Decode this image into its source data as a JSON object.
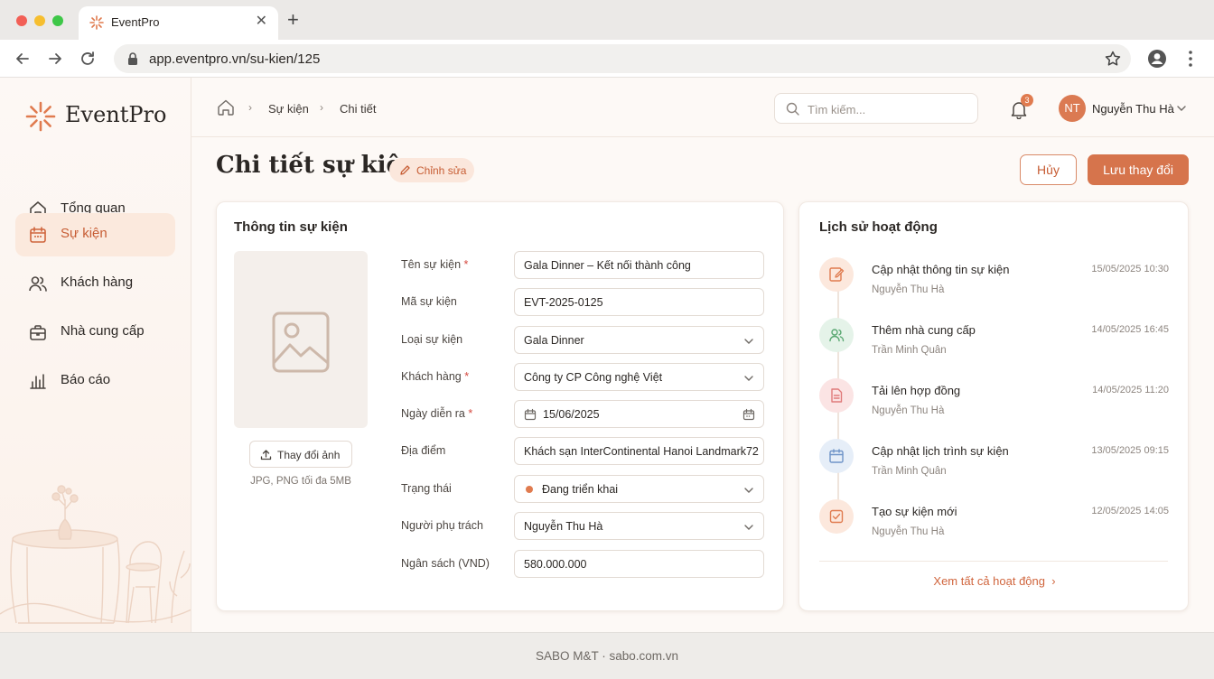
{
  "browser": {
    "tab_title": "EventPro",
    "url": "app.eventpro.vn/su-kien/125"
  },
  "brand": {
    "name": "EventPro",
    "accent": "#d6744c"
  },
  "sidebar": {
    "items": [
      {
        "label": "Tổng quan",
        "icon": "home-icon"
      },
      {
        "label": "Sự kiện",
        "icon": "calendar-icon",
        "active": true
      },
      {
        "label": "Khách hàng",
        "icon": "users-icon"
      },
      {
        "label": "Nhà cung cấp",
        "icon": "briefcase-icon"
      },
      {
        "label": "Báo cáo",
        "icon": "bar-chart-icon"
      }
    ]
  },
  "breadcrumb": [
    "Sự kiện",
    "Chi tiết"
  ],
  "header": {
    "search_placeholder": "Tìm kiếm...",
    "notification_count": "3",
    "user_initials": "NT",
    "user_name": "Nguyễn Thu Hà"
  },
  "page": {
    "title": "Chi tiết sự kiện",
    "edit_label": "Chỉnh sửa",
    "cancel_label": "Hủy",
    "save_label": "Lưu thay đổi"
  },
  "event_info": {
    "title": "Thông tin sự kiện",
    "change_image_label": "Thay đổi ảnh",
    "image_hint": "JPG, PNG tối đa 5MB",
    "fields": [
      {
        "label": "Tên sự kiện",
        "required": true,
        "value": "Gala Dinner – Kết nối thành công",
        "type": "text"
      },
      {
        "label": "Mã sự kiện",
        "required": false,
        "value": "EVT-2025-0125",
        "type": "text"
      },
      {
        "label": "Loại sự kiện",
        "required": false,
        "value": "Gala Dinner",
        "type": "select"
      },
      {
        "label": "Khách hàng",
        "required": true,
        "value": "Công ty CP Công nghệ Việt",
        "type": "select"
      },
      {
        "label": "Ngày diễn ra",
        "required": true,
        "value": "15/06/2025",
        "type": "date"
      },
      {
        "label": "Địa điểm",
        "required": false,
        "value": "Khách sạn InterContinental Hanoi Landmark72",
        "type": "text"
      },
      {
        "label": "Trạng thái",
        "required": false,
        "value": "Đang triển khai",
        "type": "status"
      },
      {
        "label": "Người phụ trách",
        "required": false,
        "value": "Nguyễn Thu Hà",
        "type": "select"
      },
      {
        "label": "Ngân sách (VND)",
        "required": false,
        "value": "580.000.000",
        "type": "text"
      }
    ]
  },
  "activity": {
    "title": "Lịch sử hoạt động",
    "items": [
      {
        "title": "Cập nhật thông tin sự kiện",
        "user": "Nguyễn Thu Hà",
        "time": "15/05/2025 10:30",
        "icon": "edit-note-icon",
        "color": "#e07b4f"
      },
      {
        "title": "Thêm nhà cung cấp",
        "user": "Trần Minh Quân",
        "time": "14/05/2025 16:45",
        "icon": "users-icon",
        "color": "#5aa872"
      },
      {
        "title": "Tải lên hợp đồng",
        "user": "Nguyễn Thu Hà",
        "time": "14/05/2025 11:20",
        "icon": "document-icon",
        "color": "#e07b7b"
      },
      {
        "title": "Cập nhật lịch trình sự kiện",
        "user": "Trần Minh Quân",
        "time": "13/05/2025 09:15",
        "icon": "calendar-icon",
        "color": "#6f94c8"
      },
      {
        "title": "Tạo sự kiện mới",
        "user": "Nguyễn Thu Hà",
        "time": "12/05/2025 14:05",
        "icon": "check-square-icon",
        "color": "#e07b4f"
      }
    ],
    "see_all_label": "Xem tất cả hoạt động"
  },
  "footer": {
    "text": "SABO M&T · sabo.com.vn"
  }
}
